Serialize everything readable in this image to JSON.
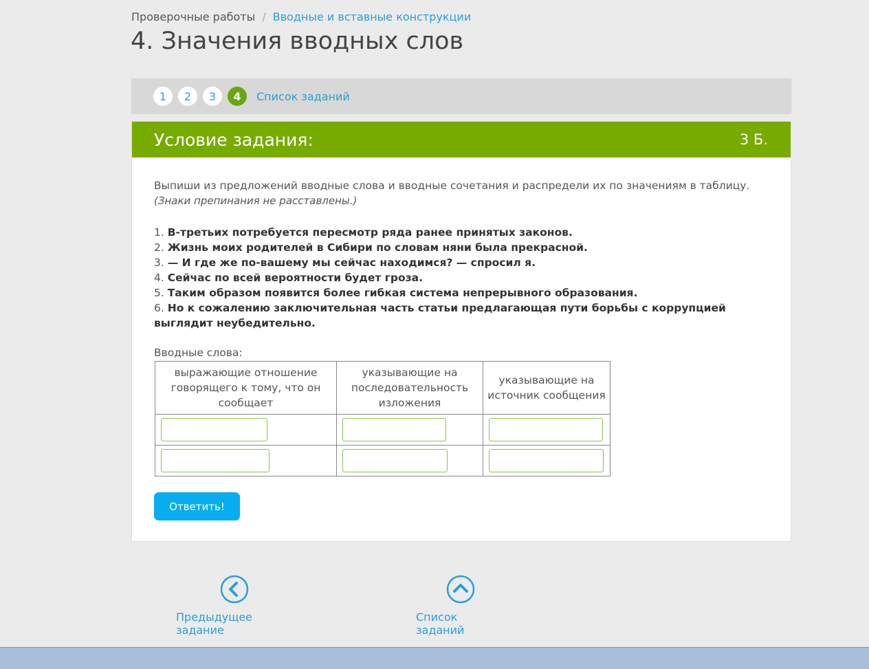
{
  "breadcrumb": {
    "parent": "Проверочные работы",
    "separator": "/",
    "current": "Вводные и вставные конструкции"
  },
  "page_title": "4. Значения вводных слов",
  "steps": {
    "items": [
      "1",
      "2",
      "3",
      "4"
    ],
    "active": "4",
    "list_link": "Список заданий"
  },
  "task": {
    "header_title": "Условие задания:",
    "points": "3 Б.",
    "instruction": "Выпиши из предложений вводные слова и вводные сочетания и распредели их по значениям в таблицу.",
    "note": "(Знаки препинания не расставлены.)",
    "sentences": [
      {
        "num": "1.",
        "text": "В-третьих потребуется пересмотр ряда ранее принятых законов."
      },
      {
        "num": "2.",
        "text": "Жизнь моих родителей в Сибири по словам няни была прекрасной."
      },
      {
        "num": "3.",
        "text": "— И где же по-вашему мы сейчас находимся? — спросил я."
      },
      {
        "num": "4.",
        "text": "Сейчас по всей вероятности будет гроза."
      },
      {
        "num": "5.",
        "text": "Таким образом появится более гибкая система непрерывного образования."
      },
      {
        "num": "6.",
        "text": "Но к сожалению заключительная часть статьи предлагающая пути борьбы с коррупцией выглядит неубедительно."
      }
    ],
    "table_label": "Вводные слова:",
    "columns": [
      "выражающие отношение говорящего к тому, что он сообщает",
      "указывающие на последовательность изложения",
      "указывающие на источник сообщения"
    ],
    "rows": [
      [
        "",
        "",
        ""
      ],
      [
        "",
        "",
        ""
      ]
    ],
    "submit_label": "Ответить!"
  },
  "footer_nav": {
    "prev_label": "Предыдущее задание",
    "list_label": "Список заданий"
  },
  "colors": {
    "accent_green": "#77ab00",
    "link_blue": "#2a9fd6",
    "button_blue": "#07adef"
  }
}
